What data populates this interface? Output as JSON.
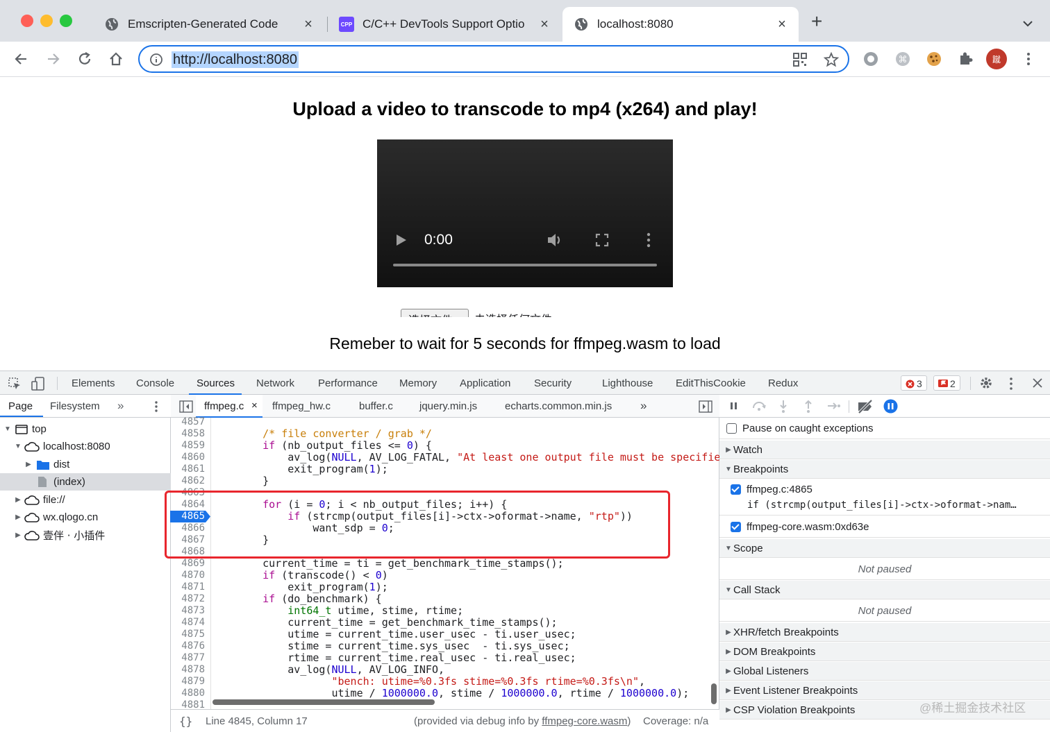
{
  "browser": {
    "tabs": [
      {
        "title": "Emscripten-Generated Code"
      },
      {
        "title": "C/C++ DevTools Support Optio",
        "favicon_text": "CPP"
      },
      {
        "title": "localhost:8080"
      }
    ],
    "url": "http://localhost:8080",
    "extension_avatar_text": "蹴"
  },
  "page": {
    "heading": "Upload a video to transcode to mp4 (x264) and play!",
    "video_time": "0:00",
    "video_progress": 0,
    "file_input_label": "选择文件",
    "file_input_status": "未选择任何文件",
    "note": "Remeber to wait for 5 seconds for ffmpeg.wasm to load"
  },
  "devtools": {
    "tabs": [
      "Elements",
      "Console",
      "Sources",
      "Network",
      "Performance",
      "Memory",
      "Application",
      "Security",
      "Lighthouse",
      "EditThisCookie",
      "Redux"
    ],
    "active_tab": "Sources",
    "error_count": "3",
    "warning_count": "2",
    "navigator": {
      "tabs": [
        "Page",
        "Filesystem"
      ],
      "more": "»",
      "tree": [
        {
          "label": "top",
          "icon": "frame-icon"
        },
        {
          "label": "localhost:8080",
          "icon": "cloud-icon"
        },
        {
          "label": "dist",
          "icon": "folder-icon"
        },
        {
          "label": "(index)",
          "icon": "file-icon"
        },
        {
          "label": "file://",
          "icon": "cloud-icon"
        },
        {
          "label": "wx.qlogo.cn",
          "icon": "cloud-icon"
        },
        {
          "label": "壹伴 · 小插件",
          "icon": "cloud-icon"
        }
      ]
    },
    "editor": {
      "tabs": [
        "ffmpeg.c",
        "ffmpeg_hw.c",
        "buffer.c",
        "jquery.min.js",
        "echarts.common.min.js"
      ],
      "more": "»",
      "close_icon": "×",
      "breakpoint_line": "4865",
      "lines": [
        {
          "n": "4857",
          "code": ""
        },
        {
          "n": "4858",
          "code": "    /* file converter / grab */"
        },
        {
          "n": "4859",
          "code": "    if (nb_output_files <= 0) {"
        },
        {
          "n": "4860",
          "code": "        av_log(NULL, AV_LOG_FATAL, \"At least one output file must be specified\\n"
        },
        {
          "n": "4861",
          "code": "        exit_program(1);"
        },
        {
          "n": "4862",
          "code": "    }"
        },
        {
          "n": "4863",
          "code": ""
        },
        {
          "n": "4864",
          "code": "    for (i = 0; i < nb_output_files; i++) {"
        },
        {
          "n": "4865",
          "code": "        if (strcmp(output_files[i]->ctx->oformat->name, \"rtp\"))"
        },
        {
          "n": "4866",
          "code": "            want_sdp = 0;"
        },
        {
          "n": "4867",
          "code": "    }"
        },
        {
          "n": "4868",
          "code": ""
        },
        {
          "n": "4869",
          "code": "    current_time = ti = get_benchmark_time_stamps();"
        },
        {
          "n": "4870",
          "code": "    if (transcode() < 0)"
        },
        {
          "n": "4871",
          "code": "        exit_program(1);"
        },
        {
          "n": "4872",
          "code": "    if (do_benchmark) {"
        },
        {
          "n": "4873",
          "code": "        int64_t utime, stime, rtime;"
        },
        {
          "n": "4874",
          "code": "        current_time = get_benchmark_time_stamps();"
        },
        {
          "n": "4875",
          "code": "        utime = current_time.user_usec - ti.user_usec;"
        },
        {
          "n": "4876",
          "code": "        stime = current_time.sys_usec  - ti.sys_usec;"
        },
        {
          "n": "4877",
          "code": "        rtime = current_time.real_usec - ti.real_usec;"
        },
        {
          "n": "4878",
          "code": "        av_log(NULL, AV_LOG_INFO,"
        },
        {
          "n": "4879",
          "code": "               \"bench: utime=%0.3fs stime=%0.3fs rtime=%0.3fs\\n\","
        },
        {
          "n": "4880",
          "code": "               utime / 1000000.0, stime / 1000000.0, rtime / 1000000.0);"
        },
        {
          "n": "4881",
          "code": ""
        }
      ],
      "status_left": "{}",
      "status_position": "Line 4845, Column 17",
      "status_provided_prefix": "(provided via debug info by ",
      "status_provided_link": "ffmpeg-core.wasm",
      "status_provided_suffix": ")",
      "status_coverage": "Coverage: n/a"
    },
    "debugger": {
      "pause_on_caught": "Pause on caught exceptions",
      "watch": "Watch",
      "breakpoints": "Breakpoints",
      "bp1_file": "ffmpeg.c:4865",
      "bp1_code": "if (strcmp(output_files[i]->ctx->oformat->nam…",
      "bp2_file": "ffmpeg-core.wasm:0xd63e",
      "scope": "Scope",
      "not_paused_1": "Not paused",
      "call_stack": "Call Stack",
      "not_paused_2": "Not paused",
      "xhr": "XHR/fetch Breakpoints",
      "dom": "DOM Breakpoints",
      "global": "Global Listeners",
      "event": "Event Listener Breakpoints",
      "csp": "CSP Violation Breakpoints"
    }
  },
  "watermark": "@稀土掘金技术社区",
  "colors": {
    "accent": "#1a73e8",
    "highlight_box": "#e8262d",
    "error": "#d93025"
  }
}
